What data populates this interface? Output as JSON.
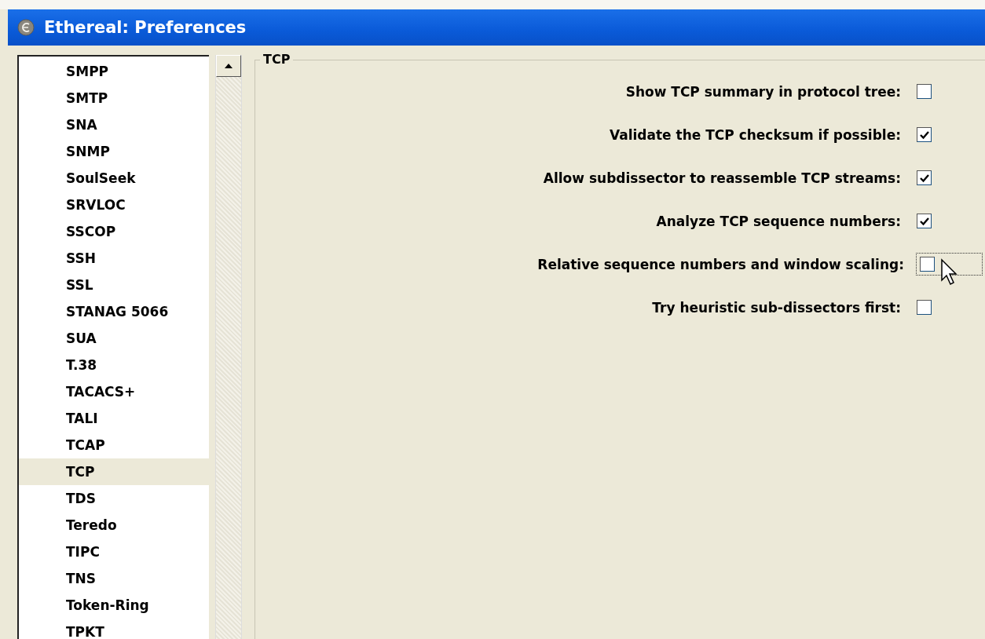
{
  "window": {
    "title": "Ethereal: Preferences"
  },
  "sidebar": {
    "items": [
      {
        "label": "SMPP",
        "selected": false
      },
      {
        "label": "SMTP",
        "selected": false
      },
      {
        "label": "SNA",
        "selected": false
      },
      {
        "label": "SNMP",
        "selected": false
      },
      {
        "label": "SoulSeek",
        "selected": false
      },
      {
        "label": "SRVLOC",
        "selected": false
      },
      {
        "label": "SSCOP",
        "selected": false
      },
      {
        "label": "SSH",
        "selected": false
      },
      {
        "label": "SSL",
        "selected": false
      },
      {
        "label": "STANAG 5066",
        "selected": false
      },
      {
        "label": "SUA",
        "selected": false
      },
      {
        "label": "T.38",
        "selected": false
      },
      {
        "label": "TACACS+",
        "selected": false
      },
      {
        "label": "TALI",
        "selected": false
      },
      {
        "label": "TCAP",
        "selected": false
      },
      {
        "label": "TCP",
        "selected": true
      },
      {
        "label": "TDS",
        "selected": false
      },
      {
        "label": "Teredo",
        "selected": false
      },
      {
        "label": "TIPC",
        "selected": false
      },
      {
        "label": "TNS",
        "selected": false
      },
      {
        "label": "Token-Ring",
        "selected": false
      },
      {
        "label": "TPKT",
        "selected": false
      }
    ]
  },
  "panel": {
    "title": "TCP",
    "options": [
      {
        "label": "Show TCP summary in protocol tree:",
        "checked": false,
        "focused": false
      },
      {
        "label": "Validate the TCP checksum if possible:",
        "checked": true,
        "focused": false
      },
      {
        "label": "Allow subdissector to reassemble TCP streams:",
        "checked": true,
        "focused": false
      },
      {
        "label": "Analyze TCP sequence numbers:",
        "checked": true,
        "focused": false
      },
      {
        "label": "Relative sequence numbers and window scaling:",
        "checked": false,
        "focused": true
      },
      {
        "label": "Try heuristic sub-dissectors first:",
        "checked": false,
        "focused": false
      }
    ]
  }
}
